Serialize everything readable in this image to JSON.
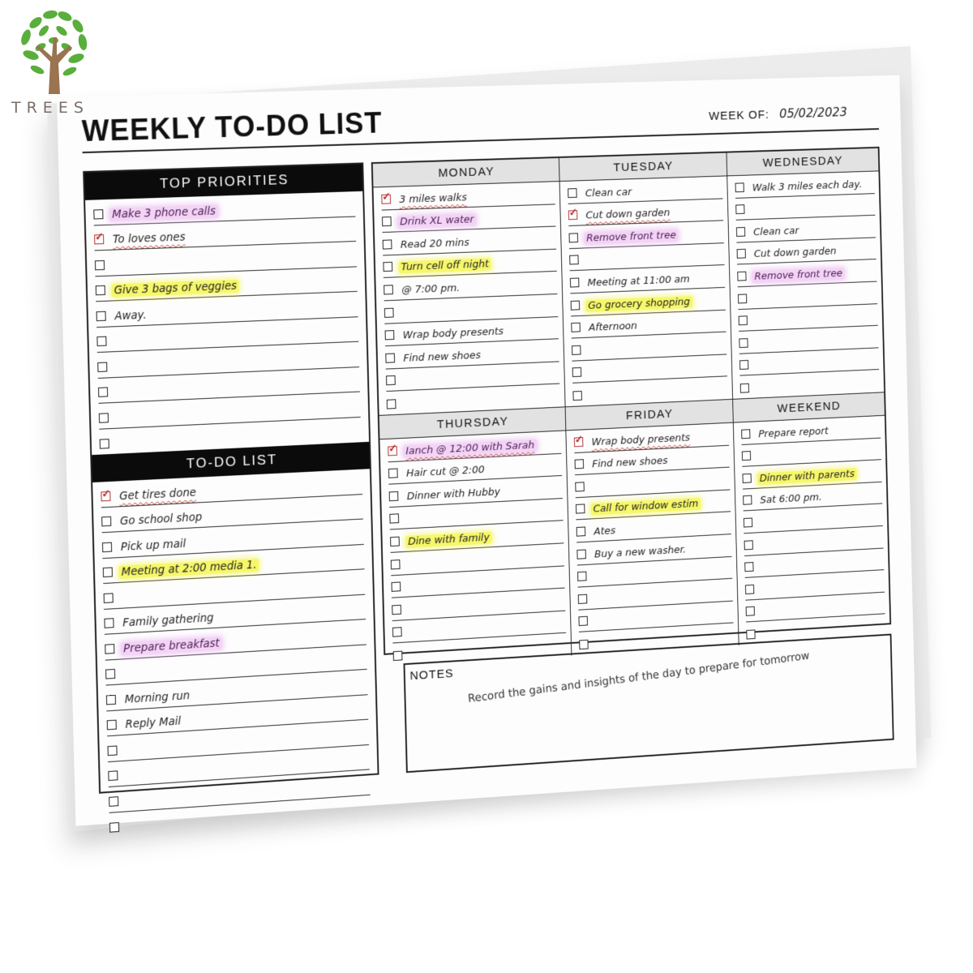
{
  "brand": {
    "name": "TREES",
    "logo_icon": "tree-icon",
    "colors": {
      "leaf": "#5aae3c",
      "trunk": "#9a7350",
      "text": "#7a6e6a"
    }
  },
  "header": {
    "title": "WEEKLY TO-DO LIST",
    "week_of_label": "WEEK OF:",
    "week_of_value": "05/02/2023"
  },
  "top_priorities": {
    "title": "TOP PRIORITIES",
    "items": [
      {
        "text": "Make 3 phone calls",
        "checked": false,
        "highlight": "pink"
      },
      {
        "text": "To loves ones",
        "checked": true,
        "highlight": ""
      },
      {
        "text": "",
        "checked": false,
        "highlight": ""
      },
      {
        "text": "Give 3 bags of veggies",
        "checked": false,
        "highlight": "yellow"
      },
      {
        "text": "Away.",
        "checked": false,
        "highlight": ""
      },
      {
        "text": "",
        "checked": false,
        "highlight": ""
      },
      {
        "text": "",
        "checked": false,
        "highlight": ""
      },
      {
        "text": "",
        "checked": false,
        "highlight": ""
      },
      {
        "text": "",
        "checked": false,
        "highlight": ""
      },
      {
        "text": "",
        "checked": false,
        "highlight": ""
      }
    ]
  },
  "todo_list": {
    "title": "TO-DO LIST",
    "items": [
      {
        "text": "Get tires done",
        "checked": true,
        "highlight": ""
      },
      {
        "text": "Go school shop",
        "checked": false,
        "highlight": ""
      },
      {
        "text": "Pick up mail",
        "checked": false,
        "highlight": ""
      },
      {
        "text": "Meeting at 2:00 media 1.",
        "checked": false,
        "highlight": "yellow"
      },
      {
        "text": "",
        "checked": false,
        "highlight": ""
      },
      {
        "text": "Family gathering",
        "checked": false,
        "highlight": ""
      },
      {
        "text": "Prepare breakfast",
        "checked": false,
        "highlight": "pink"
      },
      {
        "text": "",
        "checked": false,
        "highlight": ""
      },
      {
        "text": "Morning run",
        "checked": false,
        "highlight": ""
      },
      {
        "text": "Reply Mail",
        "checked": false,
        "highlight": ""
      },
      {
        "text": "",
        "checked": false,
        "highlight": ""
      },
      {
        "text": "",
        "checked": false,
        "highlight": ""
      },
      {
        "text": "",
        "checked": false,
        "highlight": ""
      },
      {
        "text": "",
        "checked": false,
        "highlight": ""
      }
    ]
  },
  "days": [
    {
      "name": "MONDAY",
      "items": [
        {
          "text": "3 miles walks",
          "checked": true,
          "highlight": ""
        },
        {
          "text": "Drink XL water",
          "checked": false,
          "highlight": "pink"
        },
        {
          "text": "Read 20 mins",
          "checked": false,
          "highlight": ""
        },
        {
          "text": "Turn cell off night",
          "checked": false,
          "highlight": "yellow"
        },
        {
          "text": "@ 7:00 pm.",
          "checked": false,
          "highlight": ""
        },
        {
          "text": "",
          "checked": false,
          "highlight": ""
        },
        {
          "text": "Wrap body presents",
          "checked": false,
          "highlight": ""
        },
        {
          "text": "Find new shoes",
          "checked": false,
          "highlight": ""
        },
        {
          "text": "",
          "checked": false,
          "highlight": ""
        },
        {
          "text": "",
          "checked": false,
          "highlight": ""
        }
      ]
    },
    {
      "name": "TUESDAY",
      "items": [
        {
          "text": "Clean car",
          "checked": false,
          "highlight": ""
        },
        {
          "text": "Cut down garden",
          "checked": true,
          "highlight": ""
        },
        {
          "text": "Remove front tree",
          "checked": false,
          "highlight": "pink"
        },
        {
          "text": "",
          "checked": false,
          "highlight": ""
        },
        {
          "text": "Meeting at 11:00 am",
          "checked": false,
          "highlight": ""
        },
        {
          "text": "Go grocery shopping",
          "checked": false,
          "highlight": "yellow"
        },
        {
          "text": "Afternoon",
          "checked": false,
          "highlight": ""
        },
        {
          "text": "",
          "checked": false,
          "highlight": ""
        },
        {
          "text": "",
          "checked": false,
          "highlight": ""
        },
        {
          "text": "",
          "checked": false,
          "highlight": ""
        }
      ]
    },
    {
      "name": "WEDNESDAY",
      "items": [
        {
          "text": "Walk 3 miles each day.",
          "checked": false,
          "highlight": ""
        },
        {
          "text": "",
          "checked": false,
          "highlight": ""
        },
        {
          "text": "Clean car",
          "checked": false,
          "highlight": ""
        },
        {
          "text": "Cut down garden",
          "checked": false,
          "highlight": ""
        },
        {
          "text": "Remove front tree",
          "checked": false,
          "highlight": "pink"
        },
        {
          "text": "",
          "checked": false,
          "highlight": ""
        },
        {
          "text": "",
          "checked": false,
          "highlight": ""
        },
        {
          "text": "",
          "checked": false,
          "highlight": ""
        },
        {
          "text": "",
          "checked": false,
          "highlight": ""
        },
        {
          "text": "",
          "checked": false,
          "highlight": ""
        }
      ]
    },
    {
      "name": "THURSDAY",
      "items": [
        {
          "text": "Ianch @ 12:00 with Sarah",
          "checked": true,
          "highlight": "pink"
        },
        {
          "text": "Hair cut @ 2:00",
          "checked": false,
          "highlight": ""
        },
        {
          "text": "Dinner with Hubby",
          "checked": false,
          "highlight": ""
        },
        {
          "text": "",
          "checked": false,
          "highlight": ""
        },
        {
          "text": "Dine with family",
          "checked": false,
          "highlight": "yellow"
        },
        {
          "text": "",
          "checked": false,
          "highlight": ""
        },
        {
          "text": "",
          "checked": false,
          "highlight": ""
        },
        {
          "text": "",
          "checked": false,
          "highlight": ""
        },
        {
          "text": "",
          "checked": false,
          "highlight": ""
        },
        {
          "text": "",
          "checked": false,
          "highlight": ""
        }
      ]
    },
    {
      "name": "FRIDAY",
      "items": [
        {
          "text": "Wrap body presents",
          "checked": true,
          "highlight": ""
        },
        {
          "text": "Find new shoes",
          "checked": false,
          "highlight": ""
        },
        {
          "text": "",
          "checked": false,
          "highlight": ""
        },
        {
          "text": "Call for window estim",
          "checked": false,
          "highlight": "yellow"
        },
        {
          "text": "Ates",
          "checked": false,
          "highlight": ""
        },
        {
          "text": "Buy a new washer.",
          "checked": false,
          "highlight": ""
        },
        {
          "text": "",
          "checked": false,
          "highlight": ""
        },
        {
          "text": "",
          "checked": false,
          "highlight": ""
        },
        {
          "text": "",
          "checked": false,
          "highlight": ""
        },
        {
          "text": "",
          "checked": false,
          "highlight": ""
        }
      ]
    },
    {
      "name": "WEEKEND",
      "items": [
        {
          "text": "Prepare report",
          "checked": false,
          "highlight": ""
        },
        {
          "text": "",
          "checked": false,
          "highlight": ""
        },
        {
          "text": "Dinner with parents",
          "checked": false,
          "highlight": "yellow"
        },
        {
          "text": "Sat 6:00 pm.",
          "checked": false,
          "highlight": ""
        },
        {
          "text": "",
          "checked": false,
          "highlight": ""
        },
        {
          "text": "",
          "checked": false,
          "highlight": ""
        },
        {
          "text": "",
          "checked": false,
          "highlight": ""
        },
        {
          "text": "",
          "checked": false,
          "highlight": ""
        },
        {
          "text": "",
          "checked": false,
          "highlight": ""
        },
        {
          "text": "",
          "checked": false,
          "highlight": ""
        }
      ]
    }
  ],
  "notes": {
    "label": "NOTES",
    "text": "Record the gains and insights of the day to prepare for tomorrow"
  },
  "highlight_colors": {
    "yellow": "#f6f76a",
    "pink": "#f3d4f5",
    "check": "#c02a2a",
    "header_gray": "#e2e2e2"
  }
}
